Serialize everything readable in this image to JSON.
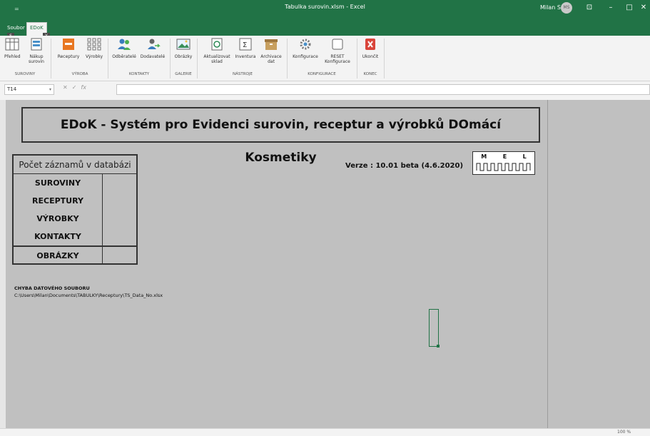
{
  "window": {
    "title": "Tabulka surovin.xlsm  -  Excel",
    "user_name": "Milan S",
    "user_initials": "MS",
    "qat_glyph": "=",
    "minimize": "–",
    "restore": "□",
    "close": "✕",
    "ribbon_display_glyph": "⊡"
  },
  "tabs": [
    {
      "label": "Soubor"
    },
    {
      "label": "EDoK",
      "keytip": "Y"
    }
  ],
  "soubor_keytip": "S",
  "ribbon": {
    "groups": [
      {
        "label": "SUROVINY"
      },
      {
        "label": "VÝROBA"
      },
      {
        "label": "KONTAKTY"
      },
      {
        "label": "GALERIE"
      },
      {
        "label": "NÁSTROJE"
      },
      {
        "label": "KONFIGURACE"
      },
      {
        "label": "KONEC"
      }
    ],
    "buttons": [
      {
        "label1": "Přehled",
        "label2": ""
      },
      {
        "label1": "Nákup",
        "label2": "surovin"
      },
      {
        "label1": "Receptury",
        "label2": ""
      },
      {
        "label1": "Výrobky",
        "label2": ""
      },
      {
        "label1": "Odběratelé",
        "label2": ""
      },
      {
        "label1": "Dodavatelé",
        "label2": ""
      },
      {
        "label1": "Obrázky",
        "label2": ""
      },
      {
        "label1": "Aktualizovat",
        "label2": "sklad"
      },
      {
        "label1": "Inventura",
        "label2": ""
      },
      {
        "label1": "Archivace",
        "label2": "dat"
      },
      {
        "label1": "Konfigurace",
        "label2": ""
      },
      {
        "label1": "RESET",
        "label2": "Konfigurace"
      },
      {
        "label1": "Ukončit",
        "label2": ""
      }
    ]
  },
  "formula_bar": {
    "name_box": "T14",
    "cancel": "✕",
    "enter": "✓",
    "fx": "fx",
    "content": ""
  },
  "sheet": {
    "title": "EDoK - Systém pro Evidenci surovin, receptur a výrobků DOmácí Kosmetiky",
    "count_header": "Počet záznamů v databázi",
    "rows": [
      {
        "label": "SUROVINY",
        "value": ""
      },
      {
        "label": "RECEPTURY",
        "value": ""
      },
      {
        "label": "VÝROBKY",
        "value": ""
      },
      {
        "label": "KONTAKTY",
        "value": ""
      },
      {
        "label": "OBRÁZKY",
        "value": ""
      }
    ],
    "version": "Verze : 10.01 beta (4.6.2020)",
    "logo": {
      "letters": [
        "M",
        "E",
        "L"
      ]
    },
    "error_title": "CHYBA DATOVÉHO SOUBORU",
    "error_path": "C:\\Users\\Milan\\Documents\\TABULKY\\Receptury\\TS_Data_No.xlsx"
  },
  "status": {
    "zoom": "100 %"
  },
  "colors": {
    "excel_green": "#217346",
    "sheet_bg": "#c0c0c0"
  }
}
